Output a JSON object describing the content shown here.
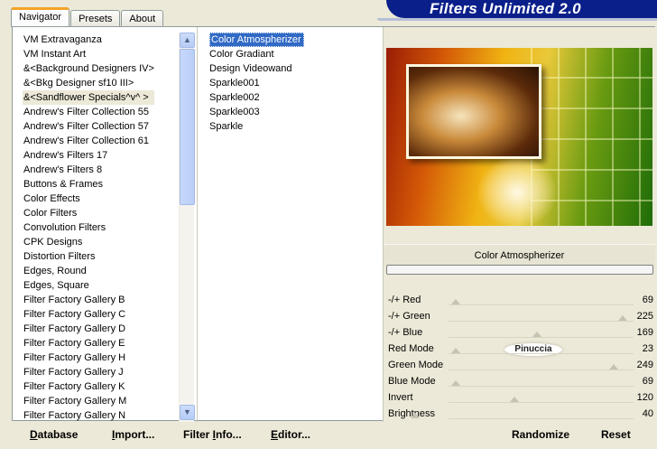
{
  "tabs": [
    {
      "label": "Navigator",
      "active": true
    },
    {
      "label": "Presets",
      "active": false
    },
    {
      "label": "About",
      "active": false
    }
  ],
  "title": "Filters Unlimited 2.0",
  "categories": [
    "VM Extravaganza",
    "VM Instant Art",
    "&<Background Designers IV>",
    "&<Bkg Designer sf10 III>",
    "&<Sandflower Specials^v^ >",
    "Andrew's Filter Collection 55",
    "Andrew's Filter Collection 57",
    "Andrew's Filter Collection 61",
    "Andrew's Filters 17",
    "Andrew's Filters 8",
    "Buttons & Frames",
    "Color Effects",
    "Color Filters",
    "Convolution Filters",
    "CPK Designs",
    "Distortion Filters",
    "Edges, Round",
    "Edges, Square",
    "Filter Factory Gallery B",
    "Filter Factory Gallery C",
    "Filter Factory Gallery D",
    "Filter Factory Gallery E",
    "Filter Factory Gallery H",
    "Filter Factory Gallery J",
    "Filter Factory Gallery K",
    "Filter Factory Gallery M",
    "Filter Factory Gallery N"
  ],
  "selected_category": "&<Sandflower Specials^v^ >",
  "filters": [
    "Color Atmospherizer",
    "Color Gradiant",
    "Design Videowand",
    "Sparkle001",
    "Sparkle002",
    "Sparkle003",
    "Sparkle"
  ],
  "selected_filter": "Color Atmospherizer",
  "preview_filter_name": "Color Atmospherizer",
  "params": [
    {
      "label": "-/+ Red",
      "value": "69"
    },
    {
      "label": "-/+ Green",
      "value": "225"
    },
    {
      "label": "-/+ Blue",
      "value": "169"
    },
    {
      "label": "Red Mode",
      "value": "23"
    },
    {
      "label": "Green Mode",
      "value": "249"
    },
    {
      "label": "Blue Mode",
      "value": "69"
    },
    {
      "label": "Invert",
      "value": "120"
    },
    {
      "label": "Brightness",
      "value": "40"
    }
  ],
  "watermark": "Pinuccia",
  "scroll_up_icon": "scroll-up-arrow",
  "scroll_down_icon": "scroll-down-arrow",
  "buttons": {
    "database": {
      "ul": "D",
      "rest": "atabase"
    },
    "import": {
      "ul": "I",
      "rest": "mport..."
    },
    "filter_info": {
      "pre": "Filter ",
      "ul": "I",
      "rest": "nfo..."
    },
    "editor": {
      "ul": "E",
      "rest": "ditor..."
    },
    "randomize": "Randomize",
    "reset": "Reset"
  },
  "accent_colors": {
    "title_bar": "#0a1f8a",
    "selection": "#316ac5",
    "tab_highlight": "#f3a32a"
  }
}
